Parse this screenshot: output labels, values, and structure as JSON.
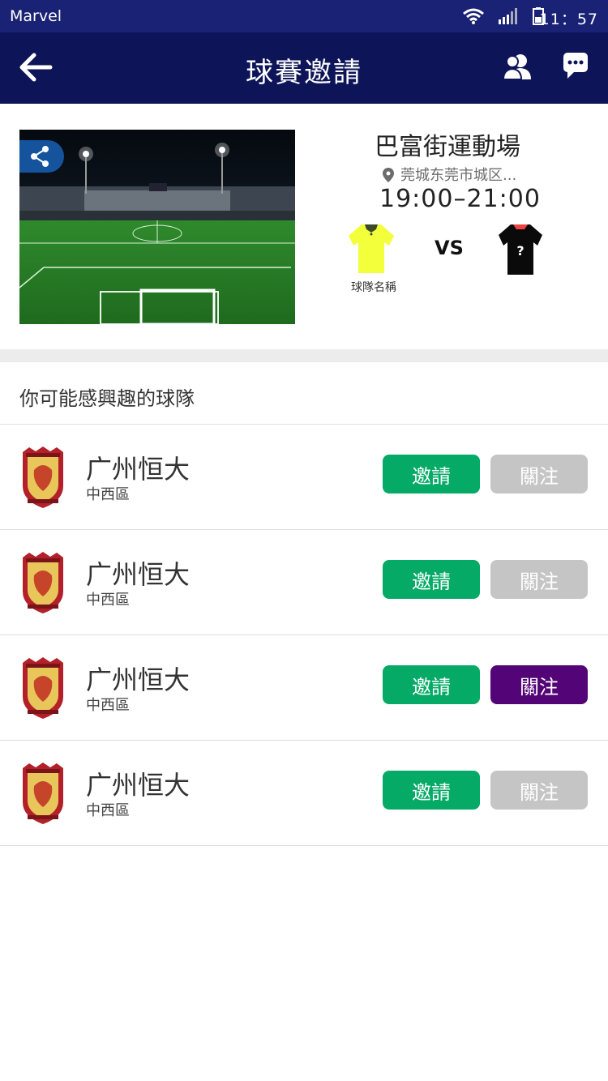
{
  "status": {
    "carrier": "Marvel",
    "time": "11：57"
  },
  "nav": {
    "title": "球賽邀請"
  },
  "match": {
    "venue": "巴富街運動場",
    "address": "莞城东莞市城区...",
    "time": "19:00–21:00",
    "vs": "VS",
    "home_team_label": "球隊名稱",
    "away_jersey_mark": "?"
  },
  "colors": {
    "status_bar": "#1a2275",
    "nav_bar": "#0d1558",
    "share_button": "#15539d",
    "address_text": "#6c6c6c",
    "divider": "#ECECEC",
    "invite_button": "#05aa66",
    "follow_button": "#C5C5C5",
    "follow_active": "#530477"
  },
  "section": {
    "title": "你可能感興趣的球隊"
  },
  "teams": [
    {
      "name": "广州恒大",
      "district": "中西區",
      "invite_label": "邀請",
      "follow_label": "關注"
    },
    {
      "name": "广州恒大",
      "district": "中西區",
      "invite_label": "邀請",
      "follow_label": "關注"
    },
    {
      "name": "广州恒大",
      "district": "中西區",
      "invite_label": "邀請",
      "follow_label": "關注"
    },
    {
      "name": "广州恒大",
      "district": "中西區",
      "invite_label": "邀請",
      "follow_label": "關注"
    }
  ]
}
